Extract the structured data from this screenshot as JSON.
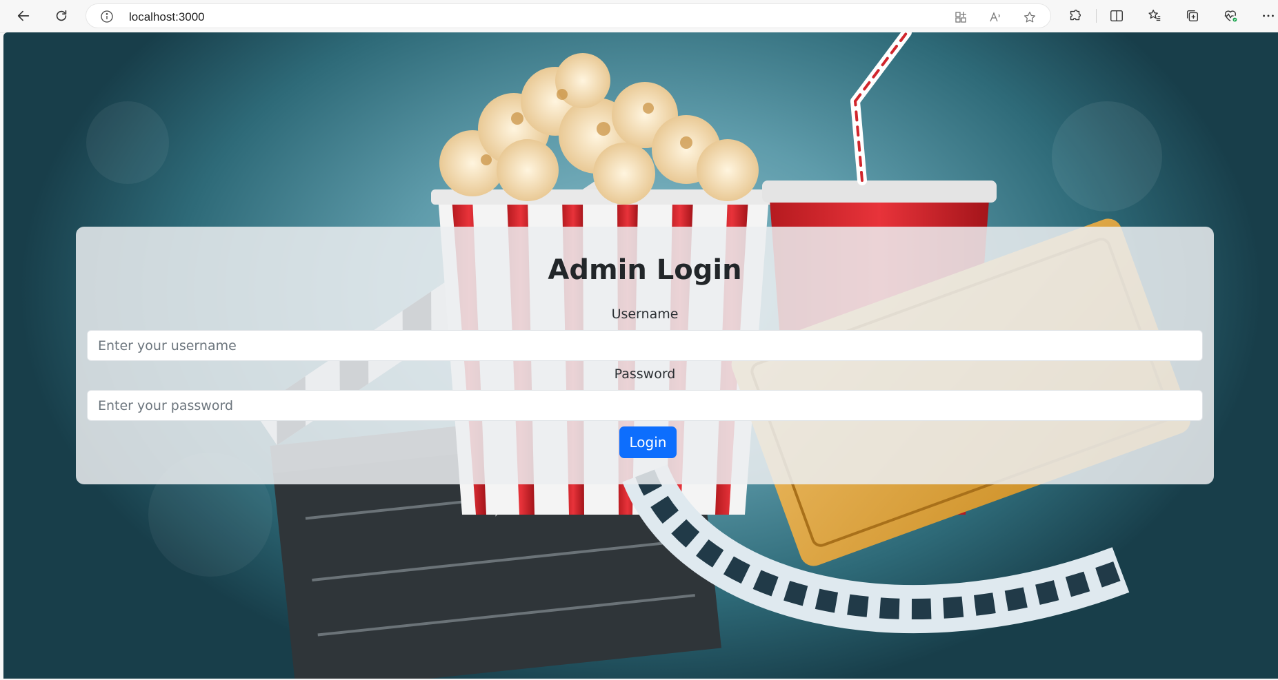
{
  "browser": {
    "url": "localhost:3000",
    "icons": {
      "back": "arrow-left-icon",
      "refresh": "refresh-icon",
      "info": "info-icon",
      "app_available": "app-grid-icon",
      "read_aloud": "read-aloud-icon",
      "favorite": "star-icon",
      "extensions": "puzzle-icon",
      "split_screen": "split-screen-icon",
      "favorites": "favorites-list-icon",
      "collections": "collections-icon",
      "browser_essentials": "heart-pulse-icon",
      "more": "more-dots-icon"
    }
  },
  "login": {
    "title": "Admin Login",
    "username_label": "Username",
    "username_placeholder": "Enter your username",
    "username_value": "",
    "password_label": "Password",
    "password_placeholder": "Enter your password",
    "password_value": "",
    "submit_label": "Login"
  },
  "colors": {
    "primary": "#0d6efd",
    "card_bg": "rgba(235,238,240,0.86)"
  },
  "background": {
    "description_icon": "cinema-popcorn-ticket-background"
  }
}
